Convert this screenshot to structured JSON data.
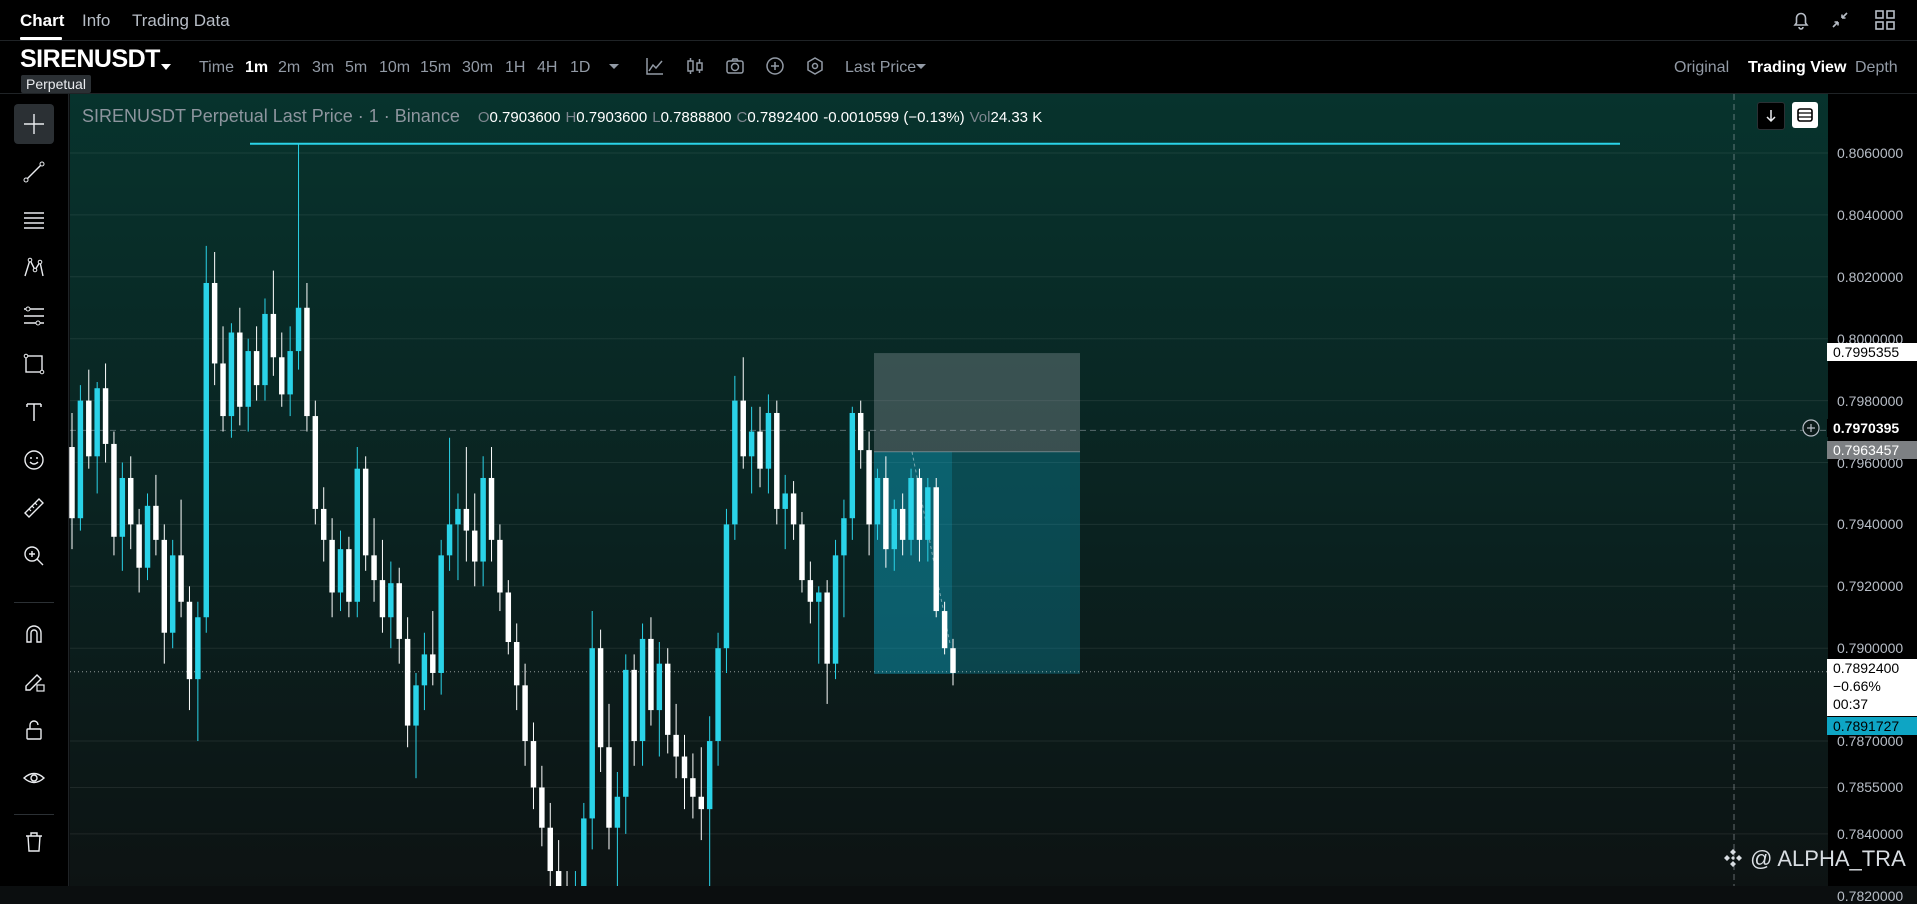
{
  "top_tabs": [
    {
      "label": "Chart",
      "active": true
    },
    {
      "label": "Info",
      "active": false
    },
    {
      "label": "Trading Data",
      "active": false
    }
  ],
  "top_icons": [
    "bell-icon",
    "collapse-arrows-icon",
    "grid-layout-icon"
  ],
  "symbol": {
    "name": "SIRENUSDT",
    "type": "Perpetual"
  },
  "timeframes": [
    {
      "label": "Time",
      "active": false
    },
    {
      "label": "1m",
      "active": true
    },
    {
      "label": "2m",
      "active": false
    },
    {
      "label": "3m",
      "active": false
    },
    {
      "label": "5m",
      "active": false
    },
    {
      "label": "10m",
      "active": false
    },
    {
      "label": "15m",
      "active": false
    },
    {
      "label": "30m",
      "active": false
    },
    {
      "label": "1H",
      "active": false
    },
    {
      "label": "4H",
      "active": false
    },
    {
      "label": "1D",
      "active": false
    }
  ],
  "toolbar_icons": [
    "chevron-down-icon",
    "indicator-icon",
    "chart-type-icon",
    "camera-icon",
    "plus-circle-icon",
    "settings-hex-icon"
  ],
  "price_type": "Last Price",
  "views": [
    {
      "label": "Original",
      "active": false
    },
    {
      "label": "Trading View",
      "active": true
    },
    {
      "label": "Depth",
      "active": false
    }
  ],
  "left_tools": [
    "crosshair-icon",
    "trend-line-icon",
    "horizontal-lines-icon",
    "pattern-icon",
    "fib-icon",
    "rectangle-icon",
    "text-icon",
    "emoji-icon",
    "ruler-icon",
    "zoom-icon",
    "magnet-icon",
    "pencil-lock-icon",
    "lock-icon",
    "eye-icon",
    "trash-icon"
  ],
  "legend": {
    "title": "SIRENUSDT Perpetual Last Price · 1 · Binance",
    "o_label": "O",
    "o": "0.7903600",
    "h_label": "H",
    "h": "0.7903600",
    "l_label": "L",
    "l": "0.7888800",
    "c_label": "C",
    "c": "0.7892400",
    "change": "-0.0010599 (−0.13%)",
    "vol_label": "Vol",
    "vol": "24.33 K"
  },
  "colors": {
    "up": "#2ad3e8",
    "down": "#ffffff",
    "bg_top": "#07312c",
    "bg_bottom": "#0c1212",
    "accent": "#0ea5c4"
  },
  "chart_data": {
    "type": "candlestick",
    "y_axis_ticks": [
      "0.8060000",
      "0.8040000",
      "0.8020000",
      "0.8000000",
      "0.7980000",
      "0.7960000",
      "0.7940000",
      "0.7920000",
      "0.7900000",
      "0.7870000",
      "0.7855000",
      "0.7840000",
      "0.7820000"
    ],
    "current_price": "0.7892400",
    "current_change": "−0.66%",
    "countdown": "00:37",
    "marked_prices": {
      "upper_box": "0.7995355",
      "crosshair": "0.7970395",
      "entry": "0.7963457",
      "target": "0.7891727"
    },
    "candles": [
      {
        "o": 0.7965,
        "h": 0.7976,
        "l": 0.7932,
        "c": 0.7942
      },
      {
        "o": 0.7942,
        "h": 0.7985,
        "l": 0.7938,
        "c": 0.798
      },
      {
        "o": 0.798,
        "h": 0.799,
        "l": 0.7958,
        "c": 0.7962
      },
      {
        "o": 0.7962,
        "h": 0.7986,
        "l": 0.795,
        "c": 0.7984
      },
      {
        "o": 0.7984,
        "h": 0.7992,
        "l": 0.796,
        "c": 0.7966
      },
      {
        "o": 0.7966,
        "h": 0.797,
        "l": 0.793,
        "c": 0.7936
      },
      {
        "o": 0.7936,
        "h": 0.796,
        "l": 0.7925,
        "c": 0.7955
      },
      {
        "o": 0.7955,
        "h": 0.7962,
        "l": 0.7932,
        "c": 0.794
      },
      {
        "o": 0.794,
        "h": 0.7945,
        "l": 0.7918,
        "c": 0.7926
      },
      {
        "o": 0.7926,
        "h": 0.795,
        "l": 0.7922,
        "c": 0.7946
      },
      {
        "o": 0.7946,
        "h": 0.7956,
        "l": 0.793,
        "c": 0.7935
      },
      {
        "o": 0.7935,
        "h": 0.794,
        "l": 0.7895,
        "c": 0.7905
      },
      {
        "o": 0.7905,
        "h": 0.7935,
        "l": 0.79,
        "c": 0.793
      },
      {
        "o": 0.793,
        "h": 0.7948,
        "l": 0.791,
        "c": 0.7915
      },
      {
        "o": 0.7915,
        "h": 0.792,
        "l": 0.788,
        "c": 0.789
      },
      {
        "o": 0.789,
        "h": 0.7915,
        "l": 0.787,
        "c": 0.791
      },
      {
        "o": 0.791,
        "h": 0.803,
        "l": 0.7905,
        "c": 0.8018
      },
      {
        "o": 0.8018,
        "h": 0.8028,
        "l": 0.7985,
        "c": 0.7992
      },
      {
        "o": 0.7992,
        "h": 0.8004,
        "l": 0.797,
        "c": 0.7975
      },
      {
        "o": 0.7975,
        "h": 0.8005,
        "l": 0.7968,
        "c": 0.8002
      },
      {
        "o": 0.8002,
        "h": 0.801,
        "l": 0.7972,
        "c": 0.7978
      },
      {
        "o": 0.7978,
        "h": 0.8,
        "l": 0.797,
        "c": 0.7996
      },
      {
        "o": 0.7996,
        "h": 0.8004,
        "l": 0.798,
        "c": 0.7985
      },
      {
        "o": 0.7985,
        "h": 0.8013,
        "l": 0.798,
        "c": 0.8008
      },
      {
        "o": 0.8008,
        "h": 0.8022,
        "l": 0.7988,
        "c": 0.7994
      },
      {
        "o": 0.7994,
        "h": 0.8002,
        "l": 0.7978,
        "c": 0.7982
      },
      {
        "o": 0.7982,
        "h": 0.8004,
        "l": 0.7975,
        "c": 0.7996
      },
      {
        "o": 0.7996,
        "h": 0.8063,
        "l": 0.799,
        "c": 0.801
      },
      {
        "o": 0.801,
        "h": 0.8018,
        "l": 0.797,
        "c": 0.7975
      },
      {
        "o": 0.7975,
        "h": 0.798,
        "l": 0.794,
        "c": 0.7945
      },
      {
        "o": 0.7945,
        "h": 0.7952,
        "l": 0.7928,
        "c": 0.7935
      },
      {
        "o": 0.7935,
        "h": 0.7942,
        "l": 0.791,
        "c": 0.7918
      },
      {
        "o": 0.7918,
        "h": 0.7938,
        "l": 0.7912,
        "c": 0.7932
      },
      {
        "o": 0.7932,
        "h": 0.7936,
        "l": 0.791,
        "c": 0.7915
      },
      {
        "o": 0.7915,
        "h": 0.7965,
        "l": 0.791,
        "c": 0.7958
      },
      {
        "o": 0.7958,
        "h": 0.7962,
        "l": 0.7925,
        "c": 0.793
      },
      {
        "o": 0.793,
        "h": 0.7942,
        "l": 0.7915,
        "c": 0.7922
      },
      {
        "o": 0.7922,
        "h": 0.7935,
        "l": 0.7905,
        "c": 0.791
      },
      {
        "o": 0.791,
        "h": 0.7928,
        "l": 0.79,
        "c": 0.7921
      },
      {
        "o": 0.7921,
        "h": 0.7926,
        "l": 0.7895,
        "c": 0.7903
      },
      {
        "o": 0.7903,
        "h": 0.791,
        "l": 0.7868,
        "c": 0.7875
      },
      {
        "o": 0.7875,
        "h": 0.7892,
        "l": 0.7858,
        "c": 0.7888
      },
      {
        "o": 0.7888,
        "h": 0.7905,
        "l": 0.788,
        "c": 0.7898
      },
      {
        "o": 0.7898,
        "h": 0.7912,
        "l": 0.7888,
        "c": 0.7892
      },
      {
        "o": 0.7892,
        "h": 0.7935,
        "l": 0.7885,
        "c": 0.793
      },
      {
        "o": 0.793,
        "h": 0.7968,
        "l": 0.7925,
        "c": 0.794
      },
      {
        "o": 0.794,
        "h": 0.795,
        "l": 0.7922,
        "c": 0.7945
      },
      {
        "o": 0.7945,
        "h": 0.7965,
        "l": 0.7928,
        "c": 0.7938
      },
      {
        "o": 0.7938,
        "h": 0.795,
        "l": 0.792,
        "c": 0.7928
      },
      {
        "o": 0.7928,
        "h": 0.7962,
        "l": 0.792,
        "c": 0.7955
      },
      {
        "o": 0.7955,
        "h": 0.7965,
        "l": 0.7928,
        "c": 0.7935
      },
      {
        "o": 0.7935,
        "h": 0.794,
        "l": 0.7912,
        "c": 0.7918
      },
      {
        "o": 0.7918,
        "h": 0.7922,
        "l": 0.7898,
        "c": 0.7902
      },
      {
        "o": 0.7902,
        "h": 0.7908,
        "l": 0.788,
        "c": 0.7888
      },
      {
        "o": 0.7888,
        "h": 0.7895,
        "l": 0.7862,
        "c": 0.787
      },
      {
        "o": 0.787,
        "h": 0.7876,
        "l": 0.7848,
        "c": 0.7855
      },
      {
        "o": 0.7855,
        "h": 0.7862,
        "l": 0.7836,
        "c": 0.7842
      },
      {
        "o": 0.7842,
        "h": 0.785,
        "l": 0.782,
        "c": 0.7828
      },
      {
        "o": 0.7828,
        "h": 0.7838,
        "l": 0.781,
        "c": 0.7818
      },
      {
        "o": 0.7818,
        "h": 0.7828,
        "l": 0.781,
        "c": 0.7815
      },
      {
        "o": 0.7815,
        "h": 0.7828,
        "l": 0.781,
        "c": 0.7822
      },
      {
        "o": 0.7822,
        "h": 0.785,
        "l": 0.7815,
        "c": 0.7845
      },
      {
        "o": 0.7845,
        "h": 0.7912,
        "l": 0.7835,
        "c": 0.79
      },
      {
        "o": 0.79,
        "h": 0.7906,
        "l": 0.786,
        "c": 0.7868
      },
      {
        "o": 0.7868,
        "h": 0.7882,
        "l": 0.7835,
        "c": 0.7842
      },
      {
        "o": 0.7842,
        "h": 0.786,
        "l": 0.782,
        "c": 0.7852
      },
      {
        "o": 0.7852,
        "h": 0.7898,
        "l": 0.784,
        "c": 0.7893
      },
      {
        "o": 0.7893,
        "h": 0.7898,
        "l": 0.7862,
        "c": 0.787
      },
      {
        "o": 0.787,
        "h": 0.7908,
        "l": 0.7862,
        "c": 0.7903
      },
      {
        "o": 0.7903,
        "h": 0.791,
        "l": 0.7875,
        "c": 0.788
      },
      {
        "o": 0.788,
        "h": 0.7902,
        "l": 0.7865,
        "c": 0.7895
      },
      {
        "o": 0.7895,
        "h": 0.79,
        "l": 0.7866,
        "c": 0.7872
      },
      {
        "o": 0.7872,
        "h": 0.7882,
        "l": 0.7858,
        "c": 0.7865
      },
      {
        "o": 0.7865,
        "h": 0.7872,
        "l": 0.7848,
        "c": 0.7858
      },
      {
        "o": 0.7858,
        "h": 0.7866,
        "l": 0.7845,
        "c": 0.7852
      },
      {
        "o": 0.7852,
        "h": 0.7868,
        "l": 0.7838,
        "c": 0.7848
      },
      {
        "o": 0.7848,
        "h": 0.7878,
        "l": 0.7822,
        "c": 0.787
      },
      {
        "o": 0.787,
        "h": 0.7905,
        "l": 0.7862,
        "c": 0.79
      },
      {
        "o": 0.79,
        "h": 0.7945,
        "l": 0.7892,
        "c": 0.794
      },
      {
        "o": 0.794,
        "h": 0.7988,
        "l": 0.7935,
        "c": 0.798
      },
      {
        "o": 0.798,
        "h": 0.7994,
        "l": 0.7958,
        "c": 0.7962
      },
      {
        "o": 0.7962,
        "h": 0.7978,
        "l": 0.795,
        "c": 0.797
      },
      {
        "o": 0.797,
        "h": 0.7978,
        "l": 0.7952,
        "c": 0.7958
      },
      {
        "o": 0.7958,
        "h": 0.7982,
        "l": 0.795,
        "c": 0.7976
      },
      {
        "o": 0.7976,
        "h": 0.798,
        "l": 0.794,
        "c": 0.7945
      },
      {
        "o": 0.7945,
        "h": 0.7956,
        "l": 0.7932,
        "c": 0.795
      },
      {
        "o": 0.795,
        "h": 0.7954,
        "l": 0.7935,
        "c": 0.794
      },
      {
        "o": 0.794,
        "h": 0.7944,
        "l": 0.7918,
        "c": 0.7922
      },
      {
        "o": 0.7922,
        "h": 0.7928,
        "l": 0.7908,
        "c": 0.7915
      },
      {
        "o": 0.7915,
        "h": 0.792,
        "l": 0.7895,
        "c": 0.7918
      },
      {
        "o": 0.7918,
        "h": 0.7922,
        "l": 0.7882,
        "c": 0.7895
      },
      {
        "o": 0.7895,
        "h": 0.7935,
        "l": 0.789,
        "c": 0.793
      },
      {
        "o": 0.793,
        "h": 0.7948,
        "l": 0.791,
        "c": 0.7942
      },
      {
        "o": 0.7942,
        "h": 0.7978,
        "l": 0.7935,
        "c": 0.7976
      },
      {
        "o": 0.7976,
        "h": 0.798,
        "l": 0.7958,
        "c": 0.7964
      },
      {
        "o": 0.7964,
        "h": 0.797,
        "l": 0.793,
        "c": 0.794
      },
      {
        "o": 0.794,
        "h": 0.7958,
        "l": 0.7935,
        "c": 0.7955
      },
      {
        "o": 0.7955,
        "h": 0.7962,
        "l": 0.7926,
        "c": 0.7932
      },
      {
        "o": 0.7932,
        "h": 0.7948,
        "l": 0.7925,
        "c": 0.7945
      },
      {
        "o": 0.7945,
        "h": 0.795,
        "l": 0.793,
        "c": 0.7935
      },
      {
        "o": 0.7935,
        "h": 0.7958,
        "l": 0.793,
        "c": 0.7955
      },
      {
        "o": 0.7955,
        "h": 0.7958,
        "l": 0.7928,
        "c": 0.7935
      },
      {
        "o": 0.7935,
        "h": 0.7955,
        "l": 0.7928,
        "c": 0.7952
      },
      {
        "o": 0.7952,
        "h": 0.7955,
        "l": 0.791,
        "c": 0.7912
      },
      {
        "o": 0.7912,
        "h": 0.7915,
        "l": 0.7898,
        "c": 0.79
      },
      {
        "o": 0.79,
        "h": 0.7903,
        "l": 0.7888,
        "c": 0.7892
      }
    ],
    "long_position": {
      "stop": "0.7995355",
      "entry": "0.7963457",
      "target": "0.7891727"
    },
    "resistance_line": "0.8063"
  },
  "watermark": "@ ALPHA_TRA"
}
